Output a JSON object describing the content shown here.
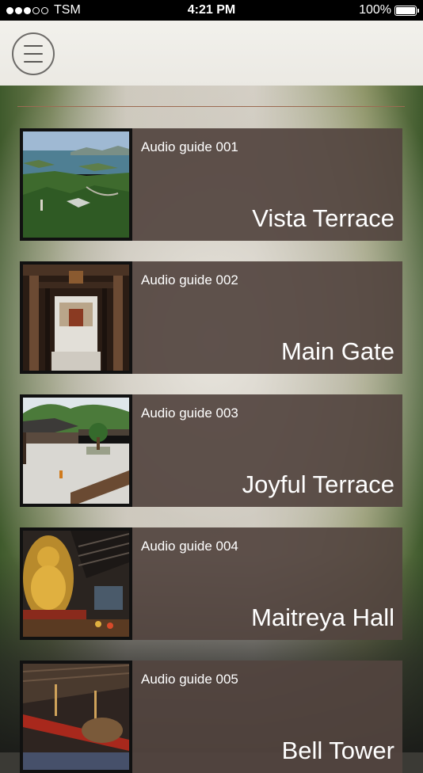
{
  "status_bar": {
    "carrier": "TSM",
    "time": "4:21 PM",
    "battery": "100%"
  },
  "header": {
    "menu_icon": "hamburger-menu-icon"
  },
  "guides": [
    {
      "number_label": "Audio guide 001",
      "title": "Vista Terrace",
      "thumbnail": "aerial landscape with sea and islands"
    },
    {
      "number_label": "Audio guide 002",
      "title": "Main Gate",
      "thumbnail": "temple gate corridor"
    },
    {
      "number_label": "Audio guide 003",
      "title": "Joyful Terrace",
      "thumbnail": "courtyard with trees and pavilion"
    },
    {
      "number_label": "Audio guide 004",
      "title": "Maitreya Hall",
      "thumbnail": "golden buddha statue in hall"
    },
    {
      "number_label": "Audio guide 005",
      "title": "Bell Tower",
      "thumbnail": "bell tower interior with beam"
    }
  ]
}
